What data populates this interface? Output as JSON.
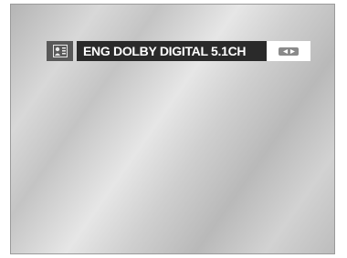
{
  "osd": {
    "audio_track_label": "ENG  DOLBY DIGITAL  5.1CH",
    "icons": {
      "audio": "audio-track-icon",
      "navigate": "left-right-arrows-icon"
    }
  },
  "colors": {
    "label_background": "#2a2a2a",
    "label_text": "#ffffff",
    "icon_background": "#595959"
  }
}
